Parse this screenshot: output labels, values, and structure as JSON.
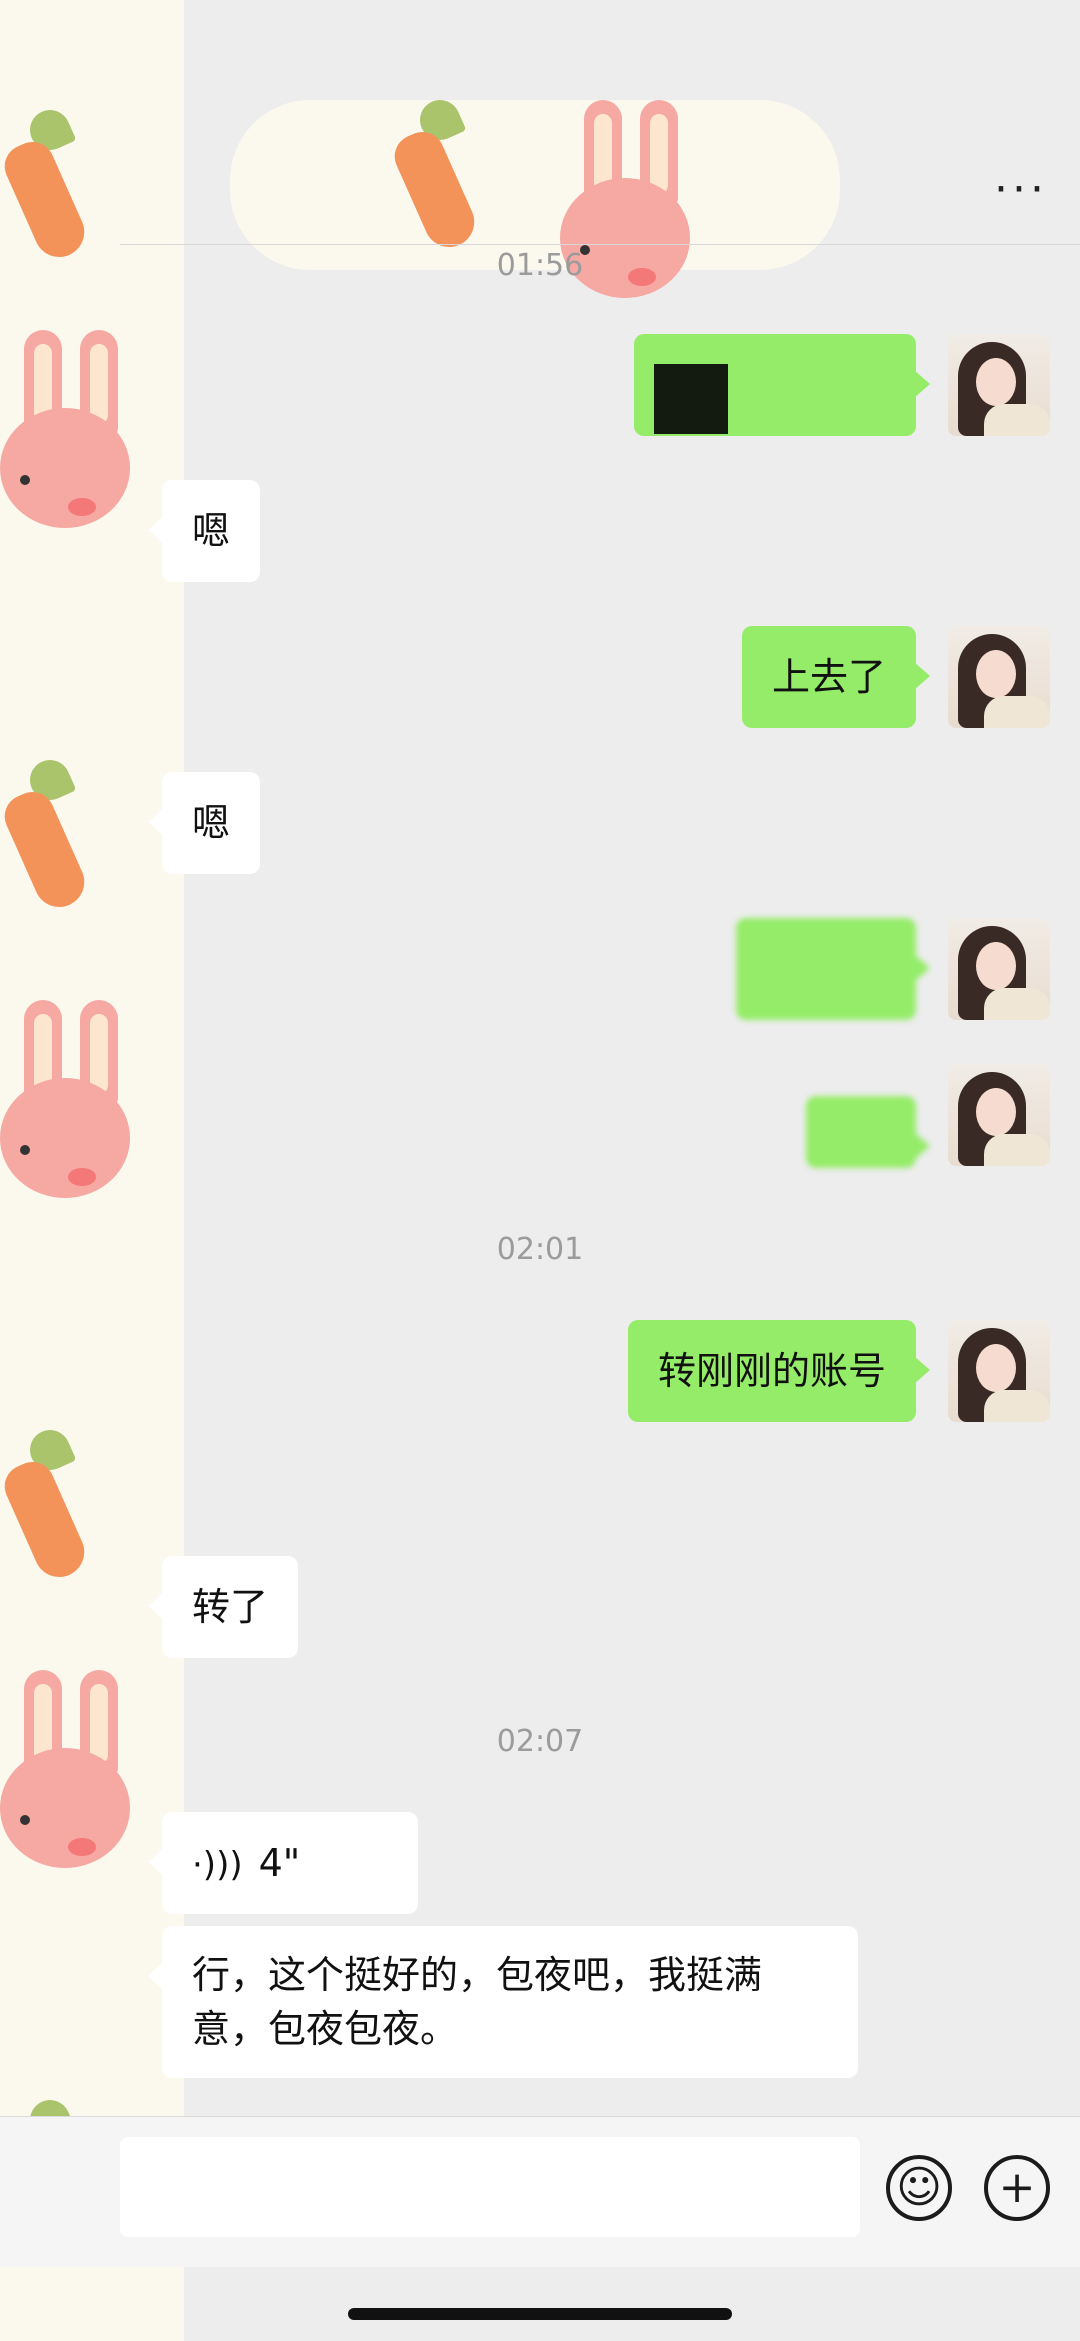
{
  "header": {
    "more_label": "···"
  },
  "messages": [
    {
      "type": "timestamp",
      "text": "01:56"
    },
    {
      "type": "out",
      "text": "",
      "note": "redacted"
    },
    {
      "type": "in",
      "text": "嗯"
    },
    {
      "type": "out",
      "text": "上去了"
    },
    {
      "type": "in",
      "text": "嗯"
    },
    {
      "type": "out",
      "text": ""
    },
    {
      "type": "out",
      "text": ""
    },
    {
      "type": "timestamp",
      "text": "02:01"
    },
    {
      "type": "out",
      "text": "转刚刚的账号"
    },
    {
      "type": "in",
      "text": "转了"
    },
    {
      "type": "timestamp",
      "text": "02:07"
    },
    {
      "type": "in-voice",
      "text": "4\""
    },
    {
      "type": "in",
      "text": "行，这个挺好的，包夜吧，我挺满意，包夜包夜。"
    }
  ],
  "composer": {
    "emoji_icon": "emoji-icon",
    "plus_icon": "plus-icon"
  }
}
